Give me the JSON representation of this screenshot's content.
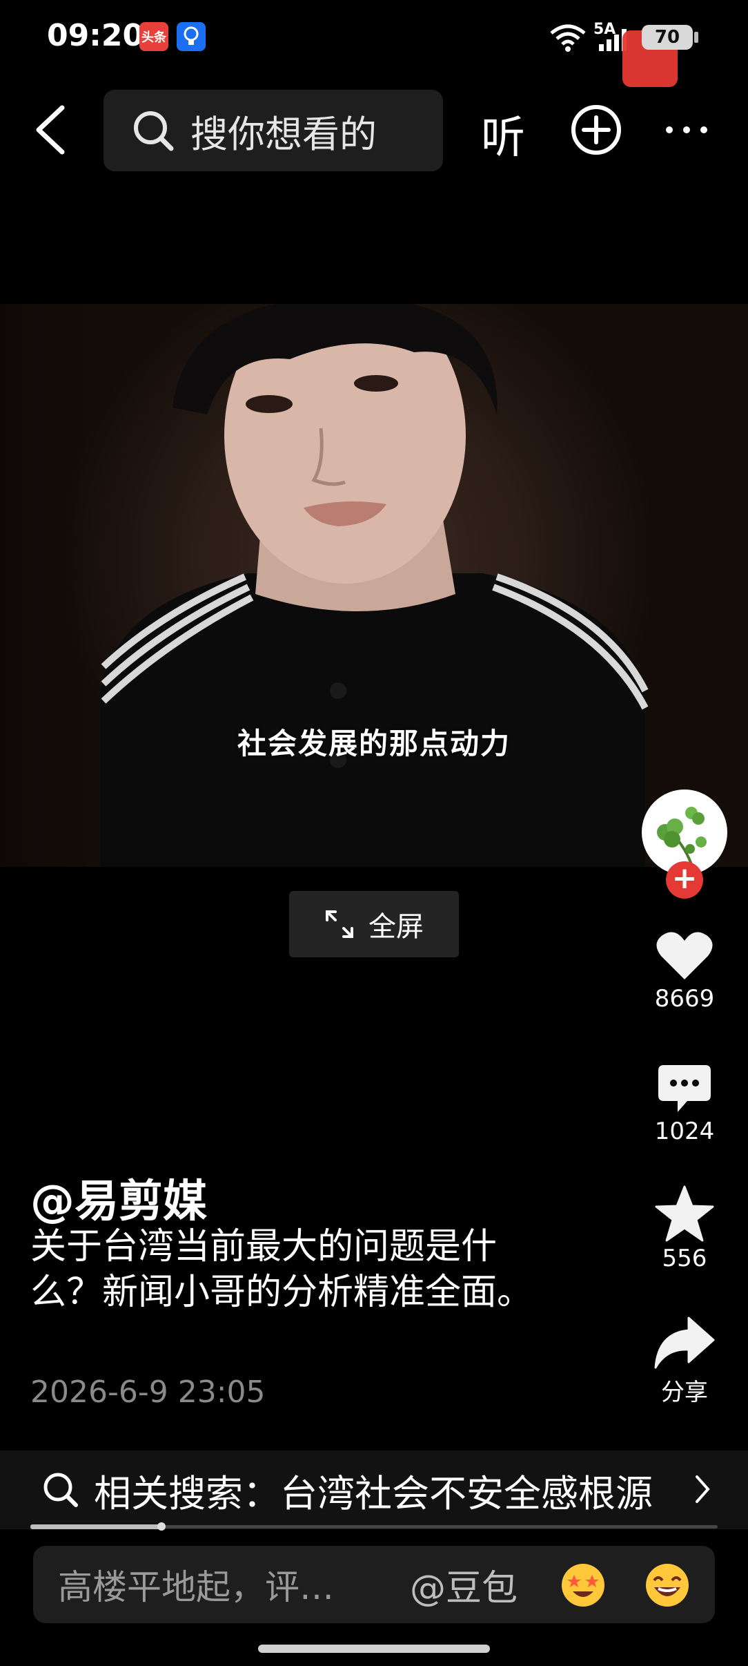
{
  "status_bar": {
    "time": "09:20",
    "app1": "头条",
    "network": "5A",
    "battery": "70"
  },
  "top_nav": {
    "search_placeholder": "搜你想看的",
    "listen_label": "听"
  },
  "video": {
    "subtitle": "社会发展的那点动力",
    "fullscreen_label": "全屏"
  },
  "actions": {
    "like_count": "8669",
    "comment_count": "1024",
    "favorite_count": "556",
    "share_label": "分享"
  },
  "post": {
    "author": "@易剪媒",
    "description": "关于台湾当前最大的问题是什么？新闻小哥的分析精准全面。",
    "date": "2026-6-9 23:05"
  },
  "related_search": {
    "text": "相关搜索：台湾社会不安全感根源"
  },
  "comment_bar": {
    "placeholder": "高楼平地起，评…",
    "mention": "@豆包"
  },
  "colors": {
    "background": "#000000",
    "accent_red": "#e53935",
    "secondary_text": "#8a8a8a"
  }
}
